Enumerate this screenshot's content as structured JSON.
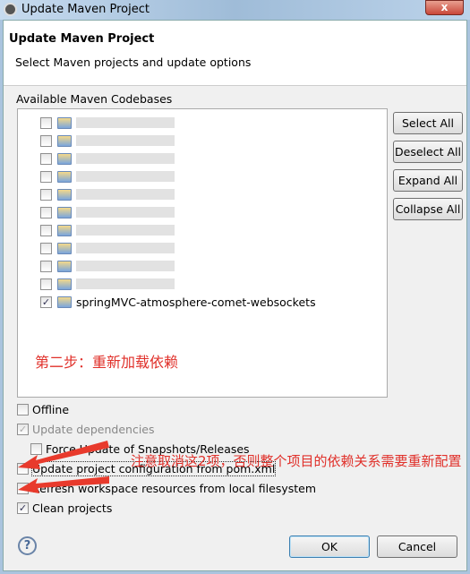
{
  "window": {
    "title": "Update Maven Project",
    "close_label": "x"
  },
  "header": {
    "title": "Update Maven Project",
    "subtitle": "Select Maven projects and update options"
  },
  "codebases": {
    "label": "Available Maven Codebases",
    "items": [
      {
        "label": "",
        "checked": false
      },
      {
        "label": "",
        "checked": false
      },
      {
        "label": "",
        "checked": false
      },
      {
        "label": "",
        "checked": false
      },
      {
        "label": "",
        "checked": false
      },
      {
        "label": "",
        "checked": false
      },
      {
        "label": "",
        "checked": false
      },
      {
        "label": "",
        "checked": false
      },
      {
        "label": "",
        "checked": false
      },
      {
        "label": "",
        "checked": false
      },
      {
        "label": "springMVC-atmosphere-comet-websockets",
        "checked": true
      }
    ]
  },
  "side_buttons": {
    "select_all": "Select All",
    "deselect_all": "Deselect All",
    "expand_all": "Expand All",
    "collapse_all": "Collapse All"
  },
  "annotation_step": "第二步：重新加载依赖",
  "annotation_note": "注意取消这2项，否则整个项目的依赖关系需要重新配置",
  "options": {
    "offline": {
      "label": "Offline",
      "checked": false
    },
    "update_dependencies": {
      "label": "Update dependencies",
      "checked": true,
      "disabled": true
    },
    "force_update": {
      "label": "Force Update of Snapshots/Releases",
      "checked": false
    },
    "update_config": {
      "label": "Update project configuration from pom.xml",
      "checked": false
    },
    "refresh_workspace": {
      "label": "Refresh workspace resources from local filesystem",
      "checked": false
    },
    "clean_projects": {
      "label": "Clean projects",
      "checked": true
    }
  },
  "footer": {
    "help": "?",
    "ok": "OK",
    "cancel": "Cancel"
  },
  "colors": {
    "annotation": "#e0302a",
    "titlebar": "#9fbcd8"
  }
}
